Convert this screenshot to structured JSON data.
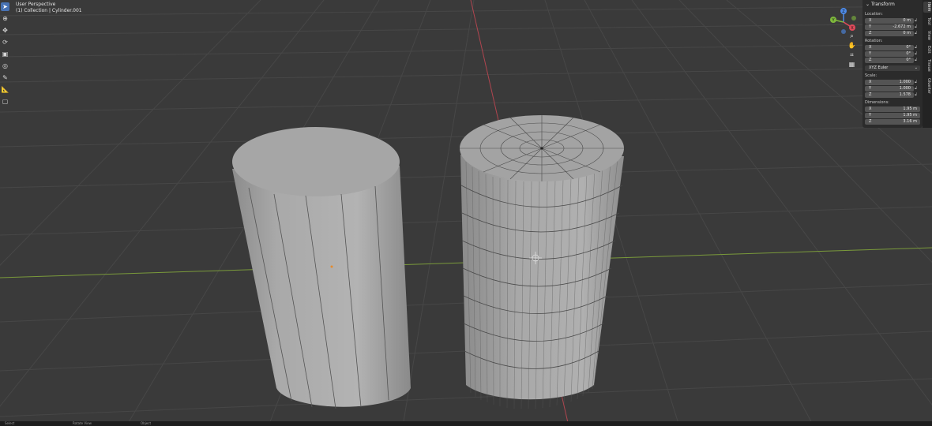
{
  "viewport": {
    "view_name": "User Perspective",
    "collection_object": "(1) Collection | Cylinder.001"
  },
  "toolbar": {
    "tools": [
      {
        "name": "select-tool",
        "glyph": "➤",
        "active": true
      },
      {
        "name": "cursor-tool",
        "glyph": "⊕",
        "active": false
      },
      {
        "name": "move-tool",
        "glyph": "✥",
        "active": false
      },
      {
        "name": "rotate-tool",
        "glyph": "⟳",
        "active": false
      },
      {
        "name": "scale-tool",
        "glyph": "▣",
        "active": false
      },
      {
        "name": "transform-tool",
        "glyph": "◎",
        "active": false
      },
      {
        "name": "annotate-tool",
        "glyph": "✎",
        "active": false
      },
      {
        "name": "measure-tool",
        "glyph": "📐",
        "active": false
      },
      {
        "name": "add-cube-tool",
        "glyph": "▢",
        "active": false
      }
    ]
  },
  "gizmo": {
    "x_label": "X",
    "y_label": "Y",
    "z_label": "Z",
    "x_color": "#e04a5a",
    "y_color": "#7fb93c",
    "z_color": "#4d8ae8"
  },
  "nav_buttons": [
    "zoom-icon",
    "hand-pan-icon",
    "camera-icon",
    "grid-perspective-icon"
  ],
  "npanel": {
    "section_title": "Transform",
    "location_label": "Location:",
    "location": [
      {
        "axis": "X",
        "value": "0 m"
      },
      {
        "axis": "Y",
        "value": "-2.672 m"
      },
      {
        "axis": "Z",
        "value": "0 m"
      }
    ],
    "rotation_label": "Rotation:",
    "rotation": [
      {
        "axis": "X",
        "value": "0°"
      },
      {
        "axis": "Y",
        "value": "0°"
      },
      {
        "axis": "Z",
        "value": "0°"
      }
    ],
    "rotation_mode": "XYZ Euler",
    "scale_label": "Scale:",
    "scale": [
      {
        "axis": "X",
        "value": "1.000"
      },
      {
        "axis": "Y",
        "value": "1.000"
      },
      {
        "axis": "Z",
        "value": "1.578"
      }
    ],
    "dimensions_label": "Dimensions:",
    "dimensions": [
      {
        "axis": "X",
        "value": "1.95 m"
      },
      {
        "axis": "Y",
        "value": "1.95 m"
      },
      {
        "axis": "Z",
        "value": "3.16 m"
      }
    ]
  },
  "sidetabs": [
    "Item",
    "Tool",
    "View",
    "Edit",
    "Tissue",
    "Glueiter"
  ],
  "statusbar": {
    "items": [
      "Select",
      "Rotate View",
      "Object"
    ]
  },
  "colors": {
    "background": "#3a3a3a",
    "grid": "#474747",
    "x_axis_line": "#b0454f",
    "y_axis_line": "#7a9a3a",
    "mesh": "#9d9d9d",
    "active_tool": "#4772b3"
  }
}
